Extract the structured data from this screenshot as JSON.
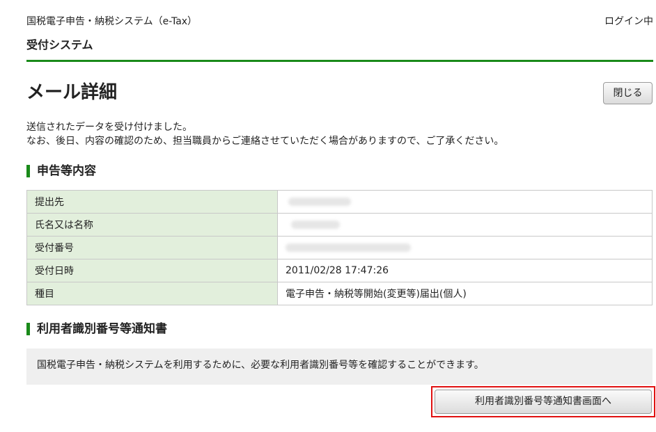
{
  "header": {
    "system_name": "国税電子申告・納税システム（e-Tax）",
    "login_status": "ログイン中",
    "subsystem": "受付システム"
  },
  "page": {
    "title": "メール詳細",
    "close_label": "閉じる",
    "intro_line1": "送信されたデータを受け付けました。",
    "intro_line2": "なお、後日、内容の確認のため、担当職員からご連絡させていただく場合がありますので、ご了承ください。"
  },
  "declaration": {
    "heading": "申告等内容",
    "rows": [
      {
        "label": "提出先",
        "value": ""
      },
      {
        "label": "氏名又は名称",
        "value": ""
      },
      {
        "label": "受付番号",
        "value": ""
      },
      {
        "label": "受付日時",
        "value": "2011/02/28 17:47:26"
      },
      {
        "label": "種目",
        "value": "電子申告・納税等開始(変更等)届出(個人)"
      }
    ]
  },
  "notice": {
    "heading": "利用者識別番号等通知書",
    "description": "国税電子申告・納税システムを利用するために、必要な利用者識別番号等を確認することができます。",
    "button_label": "利用者識別番号等通知書画面へ"
  },
  "colors": {
    "accent_green": "#1a8a1a",
    "label_cell_bg": "#e2efdc",
    "highlight_red": "#e01010"
  }
}
